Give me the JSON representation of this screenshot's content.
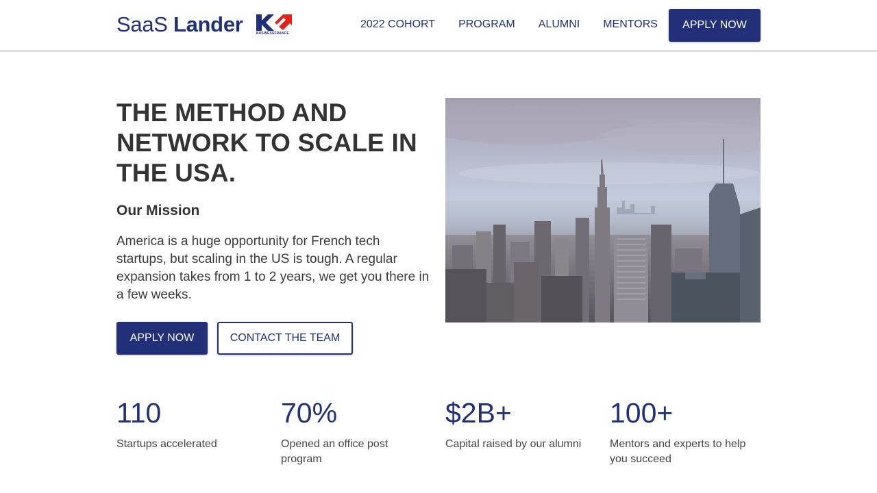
{
  "header": {
    "brand_light": "SaaS",
    "brand_bold": "Lander",
    "partner_caption": "BUSINESSFRANCE",
    "nav": [
      {
        "label": "2022 COHORT"
      },
      {
        "label": "PROGRAM"
      },
      {
        "label": "ALUMNI"
      },
      {
        "label": "MENTORS"
      }
    ],
    "apply_label": "APPLY NOW"
  },
  "hero": {
    "title": "THE METHOD AND NETWORK TO SCALE IN THE USA.",
    "mission_heading": "Our Mission",
    "mission_text": "America is a huge opportunity for French tech startups, but scaling in the US is tough. A regular expansion takes from 1 to 2 years, we get you there in a few weeks.",
    "apply_label": "APPLY NOW",
    "contact_label": "CONTACT THE TEAM"
  },
  "stats": [
    {
      "value": "110",
      "label": "Startups accelerated"
    },
    {
      "value": "70%",
      "label": "Opened an office post program"
    },
    {
      "value": "$2B+",
      "label": "Capital raised by our alumni"
    },
    {
      "value": "100+",
      "label": "Mentors and experts to help you succeed"
    }
  ],
  "colors": {
    "brand": "#22307a",
    "accent_red": "#e2231a",
    "text": "#333333"
  }
}
